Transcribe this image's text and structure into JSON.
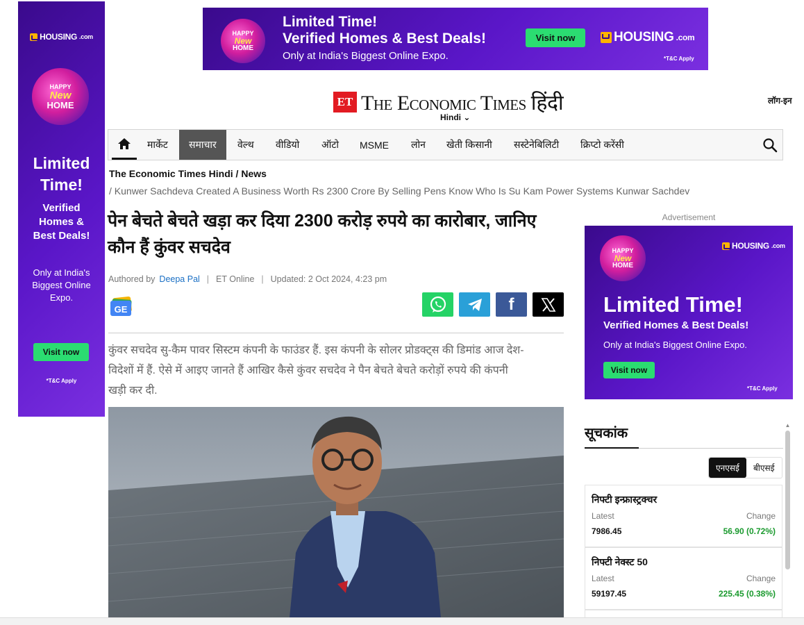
{
  "colors": {
    "ad_purple": "#4a10b0",
    "accent_green": "#2bdc71",
    "et_red": "#e21b22",
    "positive": "#1a9a2e",
    "link_blue": "#1a6fc4"
  },
  "left_ad": {
    "logo": "HOUSING",
    "logo_suffix": ".com",
    "badge": [
      "HAPPY",
      "New",
      "HOME"
    ],
    "headline": "Limited Time!",
    "sub": "Verified Homes & Best Deals!",
    "small": "Only at India's Biggest Online Expo.",
    "cta": "Visit now",
    "tc": "*T&C Apply"
  },
  "top_ad": {
    "line1": "Limited Time!",
    "line2": "Verified Homes & Best Deals!",
    "line3": "Only at India's Biggest Online Expo.",
    "cta": "Visit now",
    "logo": "HOUSING",
    "logo_suffix": ".com",
    "badge": [
      "HAPPY",
      "New",
      "HOME"
    ],
    "tc": "*T&C Apply"
  },
  "masthead": {
    "et": "ET",
    "name": "The Economic Times हिंदी",
    "edition": "Hindi",
    "login": "लॉग-इन"
  },
  "nav": {
    "items": [
      "मार्केट",
      "समाचार",
      "वेल्थ",
      "वीडियो",
      "ऑटो",
      "MSME",
      "लोन",
      "खेती किसानी",
      "सस्टेनेबिलिटी",
      "क्रिप्टो करेंसी"
    ],
    "active": "समाचार"
  },
  "breadcrumb": {
    "home": "The Economic Times Hindi",
    "section": "News",
    "page": "Kunwer Sachdeva Created A Business Worth Rs 2300 Crore By Selling Pens Know Who Is Su Kam Power Systems Kunwar Sachdev"
  },
  "article": {
    "headline": "पेन बेचते बेचते खड़ा कर दिया 2300 करोड़ रुपये का कारोबार, जानिए कौन हैं कुंवर सचदेव",
    "authored_by": "Authored by",
    "author": "Deepa Pal",
    "source": "ET Online",
    "updated": "Updated: 2 Oct 2024, 4:23 pm",
    "ge_label": "GE",
    "summary": "कुंवर सचदेव सु-कैम पावर सिस्टम कंपनी के फाउंडर हैं. इस कंपनी के सोलर प्रोडक्ट्स की डिमांड आज देश-विदेशों में हैं. ऐसे में आइए जानते हैं आखिर कैसे कुंवर सचदेव ने पैन बेचते बेचते करोड़ों रुपये की कंपनी खड़ी कर दी."
  },
  "share": {
    "icons": [
      "whatsapp-icon",
      "telegram-icon",
      "facebook-icon",
      "x-icon"
    ],
    "fb_glyph": "f"
  },
  "right_ad": {
    "label": "Advertisement",
    "logo": "HOUSING",
    "logo_suffix": ".com",
    "badge": [
      "HAPPY",
      "New",
      "HOME"
    ],
    "headline": "Limited Time!",
    "sub": "Verified Homes & Best Deals!",
    "small": "Only at India's Biggest Online Expo.",
    "cta": "Visit now",
    "tc": "*T&C Apply"
  },
  "indices": {
    "title": "सूचकांक",
    "tabs": [
      "एनएसई",
      "बीएसई"
    ],
    "active_tab": "एनएसई",
    "latest_label": "Latest",
    "change_label": "Change",
    "items": [
      {
        "name": "निफ्टी इन्फ्रास्ट्रक्चर",
        "latest": "7986.45",
        "change": "56.90 (0.72%)"
      },
      {
        "name": "निफ्टी नेक्स्ट 50",
        "latest": "59197.45",
        "change": "225.45 (0.38%)"
      }
    ]
  }
}
